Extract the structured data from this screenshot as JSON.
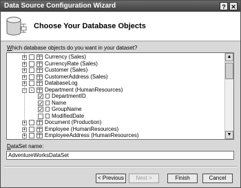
{
  "window": {
    "title": "Data Source Configuration Wizard",
    "help_glyph": "?",
    "close_glyph": "✕"
  },
  "header": {
    "title": "Choose Your Database Objects",
    "icon": "database-icon"
  },
  "prompt": {
    "accel": "W",
    "rest": "hich database objects do you want in your dataset?"
  },
  "tree": {
    "items": [
      {
        "label": "Currency (Sales)",
        "level": 0,
        "expander": "+",
        "checked": false,
        "icon": "table"
      },
      {
        "label": "CurrencyRate (Sales)",
        "level": 0,
        "expander": "+",
        "checked": false,
        "icon": "table"
      },
      {
        "label": "Customer (Sales)",
        "level": 0,
        "expander": "+",
        "checked": false,
        "icon": "table"
      },
      {
        "label": "CustomerAddress (Sales)",
        "level": 0,
        "expander": "+",
        "checked": false,
        "icon": "table"
      },
      {
        "label": "DatabaseLog",
        "level": 0,
        "expander": "+",
        "checked": false,
        "icon": "table"
      },
      {
        "label": "Department (HumanResources)",
        "level": 0,
        "expander": "−",
        "checked": "partial",
        "icon": "table"
      },
      {
        "label": "DepartmentID",
        "level": 1,
        "expander": "",
        "checked": true,
        "icon": "column"
      },
      {
        "label": "Name",
        "level": 1,
        "expander": "",
        "checked": true,
        "icon": "column"
      },
      {
        "label": "GroupName",
        "level": 1,
        "expander": "",
        "checked": true,
        "icon": "column"
      },
      {
        "label": "ModifiedDate",
        "level": 1,
        "expander": "",
        "checked": false,
        "icon": "column"
      },
      {
        "label": "Document (Production)",
        "level": 0,
        "expander": "+",
        "checked": false,
        "icon": "table"
      },
      {
        "label": "Employee (HumanResources)",
        "level": 0,
        "expander": "+",
        "checked": false,
        "icon": "table"
      },
      {
        "label": "EmployeeAddress (HumanResources)",
        "level": 0,
        "expander": "+",
        "checked": false,
        "icon": "table"
      }
    ],
    "scroll_up": "▲",
    "scroll_down": "▼"
  },
  "dataset": {
    "label_accel": "D",
    "label_rest": "ataSet name:",
    "value": "AdventureWorksDataSet"
  },
  "buttons": {
    "previous": "< Previous",
    "next": "Next >",
    "finish": "Finish",
    "cancel": "Cancel"
  },
  "colors": {
    "titlebar": "#4a4a4a",
    "dialog_bg": "#d8d8d8"
  }
}
